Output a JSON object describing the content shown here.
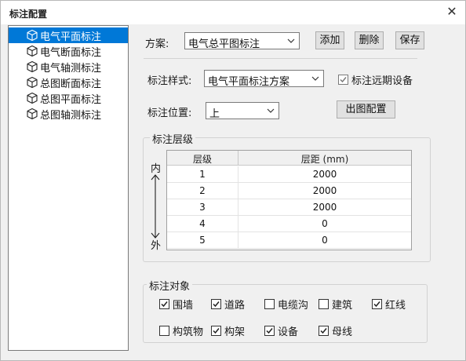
{
  "window": {
    "title": "标注配置",
    "close_glyph": "✕"
  },
  "tree": {
    "items": [
      {
        "label": "电气平面标注",
        "icon": "cube-icon",
        "selected": true
      },
      {
        "label": "电气断面标注",
        "icon": "cube-icon"
      },
      {
        "label": "电气轴测标注",
        "icon": "cube-icon"
      },
      {
        "label": "总图断面标注",
        "icon": "cube-icon"
      },
      {
        "label": "总图平面标注",
        "icon": "cube-icon"
      },
      {
        "label": "总图轴测标注",
        "icon": "cube-icon"
      }
    ]
  },
  "scheme": {
    "label": "方案:",
    "value": "电气总平图标注"
  },
  "buttons": {
    "add": "添加",
    "delete": "删除",
    "save": "保存",
    "export_config": "出图配置"
  },
  "style": {
    "label": "标注样式:",
    "value": "电气平面标注方案",
    "far_device_label": "标注远期设备",
    "far_device_checked": true
  },
  "position": {
    "label": "标注位置:",
    "value": "上"
  },
  "levels": {
    "group_title": "标注层级",
    "inner_label": "内",
    "outer_label": "外",
    "columns": [
      "层级",
      "层距 (mm)"
    ],
    "rows": [
      {
        "level": "1",
        "distance": "2000"
      },
      {
        "level": "2",
        "distance": "2000"
      },
      {
        "level": "3",
        "distance": "2000"
      },
      {
        "level": "4",
        "distance": "0"
      },
      {
        "level": "5",
        "distance": "0"
      }
    ]
  },
  "objects": {
    "group_title": "标注对象",
    "items": [
      {
        "label": "围墙",
        "checked": true
      },
      {
        "label": "道路",
        "checked": true
      },
      {
        "label": "电缆沟",
        "checked": false
      },
      {
        "label": "建筑",
        "checked": false
      },
      {
        "label": "红线",
        "checked": true
      },
      {
        "label": "构筑物",
        "checked": false
      },
      {
        "label": "构架",
        "checked": true
      },
      {
        "label": "设备",
        "checked": true
      },
      {
        "label": "母线",
        "checked": true
      }
    ]
  },
  "colors": {
    "selection": "#0078d7",
    "window_bg": "#f0f0f0"
  }
}
